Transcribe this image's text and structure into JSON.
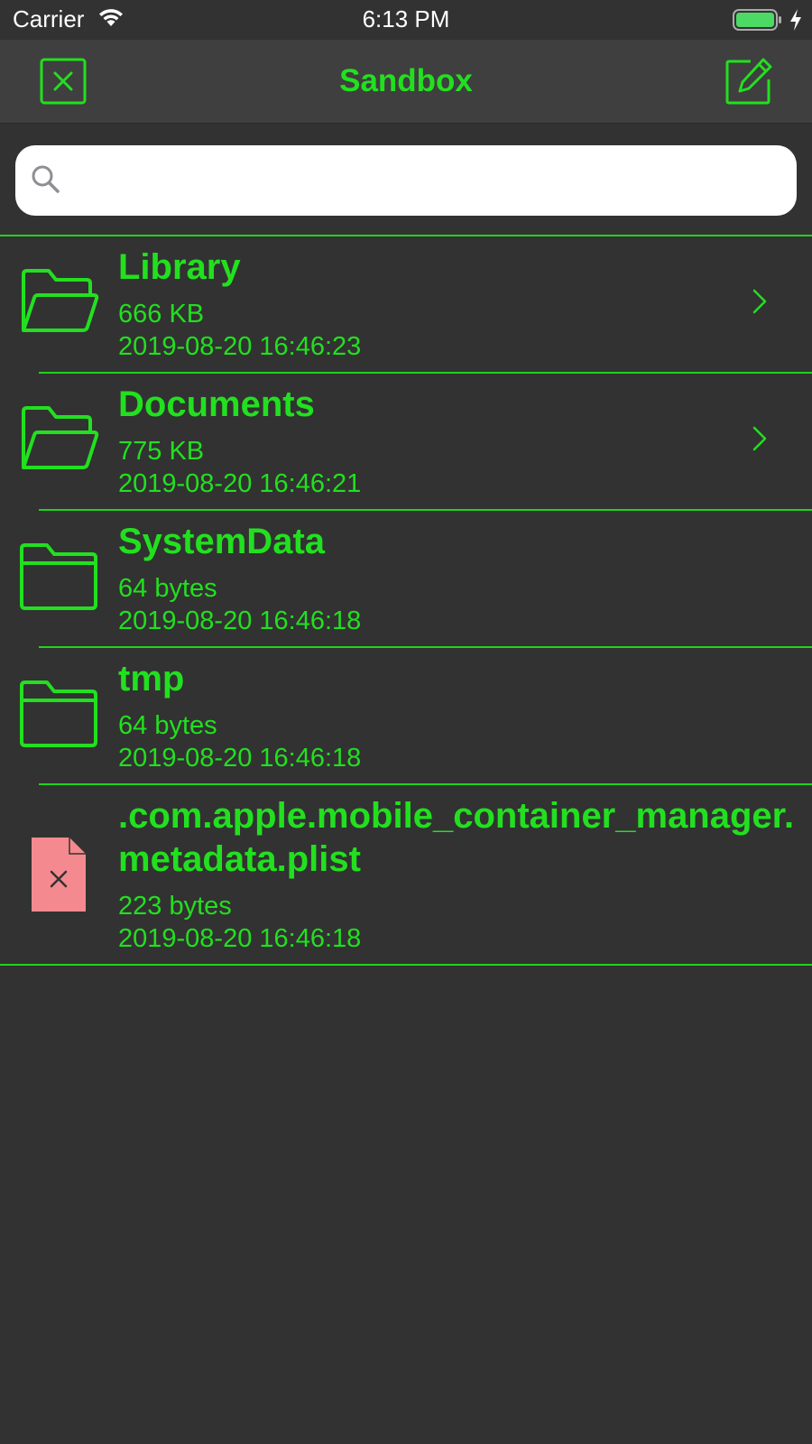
{
  "status_bar": {
    "carrier": "Carrier",
    "time": "6:13 PM",
    "icons": [
      "wifi-icon",
      "battery-icon",
      "charging-icon"
    ]
  },
  "nav": {
    "title": "Sandbox",
    "left_icon": "close-icon",
    "right_icon": "edit-icon"
  },
  "search": {
    "placeholder": "",
    "value": ""
  },
  "colors": {
    "accent": "#22e01f",
    "background": "#323232",
    "nav_background": "#3f3f3f",
    "file_icon": "#f48a8f"
  },
  "files": [
    {
      "name": "Library",
      "size": "666 KB",
      "date": "2019-08-20 16:46:23",
      "icon": "folder-open-icon",
      "has_chevron": true
    },
    {
      "name": "Documents",
      "size": "775 KB",
      "date": "2019-08-20 16:46:21",
      "icon": "folder-open-icon",
      "has_chevron": true
    },
    {
      "name": "SystemData",
      "size": "64 bytes",
      "date": "2019-08-20 16:46:18",
      "icon": "folder-icon",
      "has_chevron": false
    },
    {
      "name": "tmp",
      "size": "64 bytes",
      "date": "2019-08-20 16:46:18",
      "icon": "folder-icon",
      "has_chevron": false
    },
    {
      "name": ".com.apple.mobile_container_manager.metadata.plist",
      "size": "223 bytes",
      "date": "2019-08-20 16:46:18",
      "icon": "file-error-icon",
      "has_chevron": false
    }
  ]
}
